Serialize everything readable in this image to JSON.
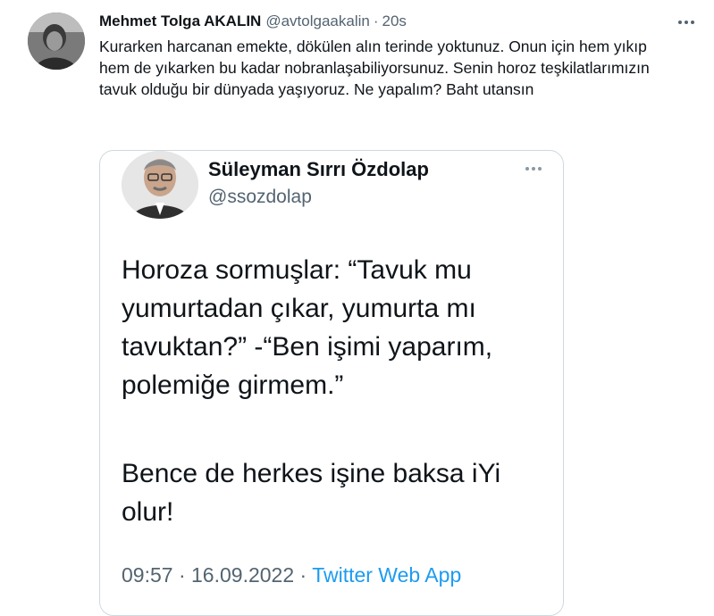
{
  "tweet": {
    "author_name": "Mehmet Tolga AKALIN",
    "author_handle": "@avtolgaakalin",
    "separator": "·",
    "time": "20s",
    "text": "Kurarken harcanan emekte, dökülen alın terinde yoktunuz. Onun için hem yıkıp hem de yıkarken bu kadar nobranlaşabiliyorsunuz. Senin horoz teşkilatlarımızın tavuk olduğu bir dünyada yaşıyoruz. Ne yapalım? Baht utansın"
  },
  "quoted": {
    "author_name": "Süleyman Sırrı Özdolap",
    "author_handle": "@ssozdolap",
    "paragraph1": "Horoza sormuşlar: “Tavuk mu yumurtadan çıkar, yumurta mı tavuktan?” -“Ben işimi yaparım, polemiğe girmem.”",
    "paragraph2": "Bence de herkes işine baksa iYi olur!",
    "time": "09:57",
    "dot1": "·",
    "date": "16.09.2022",
    "dot2": "·",
    "app": "Twitter Web App"
  },
  "icons": {
    "more": "more-horizontal-icon",
    "quoted_more": "more-horizontal-icon"
  },
  "colors": {
    "text": "#0f1419",
    "secondary": "#536471",
    "link": "#1d9bf0",
    "border": "#cfd9de"
  }
}
